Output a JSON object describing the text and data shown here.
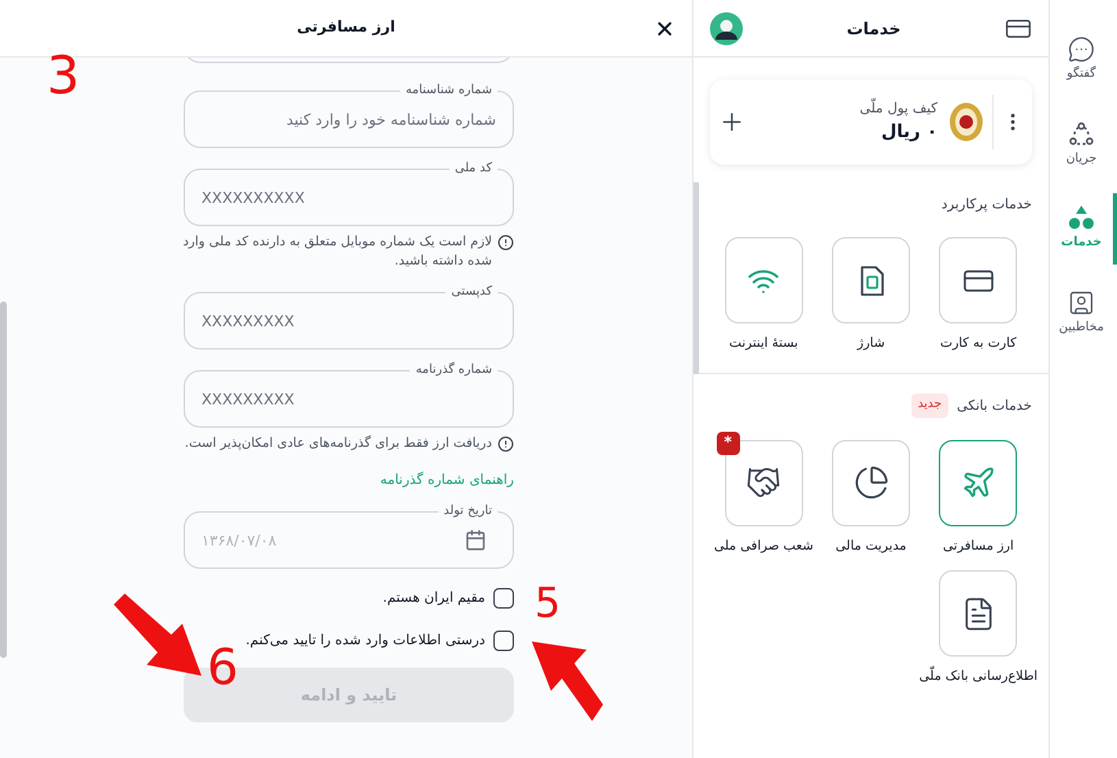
{
  "dialog": {
    "title": "ارز مسافرتی",
    "fields": [
      {
        "kind": "rtl",
        "label": "شماره شناسنامه",
        "placeholder": "شماره شناسنامه خود را وارد کنید"
      },
      {
        "kind": "ltr",
        "label": "کد ملی",
        "placeholder": "XXXXXXXXXX",
        "hint": "لازم است یک شماره موبایل متعلق به دارنده کد ملی وارد شده داشته باشید."
      },
      {
        "kind": "ltr",
        "label": "کدپستی",
        "placeholder": "XXXXXXXXX"
      },
      {
        "kind": "ltr",
        "label": "شماره گذرنامه",
        "placeholder": "XXXXXXXXX",
        "hint": "دریافت ارز فقط برای گذرنامه‌های عادی امکان‌پذیر است.",
        "link": "راهنمای شماره گذرنامه"
      },
      {
        "kind": "date",
        "label": "تاریخ تولد",
        "placeholder": "۱۳۶۸/۰۷/۰۸"
      }
    ],
    "checkboxes": [
      {
        "label": "مقیم ایران هستم.",
        "checked": false
      },
      {
        "label": "درستی اطلاعات وارد شده را تایید می‌کنم.",
        "checked": false
      }
    ],
    "submit": {
      "label": "تایید و ادامه",
      "disabled": true
    }
  },
  "services": {
    "title": "خدمات",
    "wallet": {
      "title": "کیف پول ملّی",
      "balance": "۰ ریال"
    },
    "sections": [
      {
        "title": "خدمات پرکاربرد",
        "tiles": [
          {
            "label": "کارت به کارت",
            "selected": false
          },
          {
            "label": "شارژ",
            "selected": false
          },
          {
            "label": "بستهٔ اینترنت",
            "selected": false
          }
        ]
      },
      {
        "title": "خدمات بانکی",
        "badge": "جدید",
        "tiles": [
          {
            "label": "ارز مسافرتی",
            "selected": true
          },
          {
            "label": "مدیریت مالی",
            "selected": false
          },
          {
            "label": "شعب صرافی ملی",
            "selected": false,
            "badge": "*"
          },
          {
            "label": "اطلاع‌رسانی بانک ملّی",
            "selected": false
          }
        ]
      }
    ]
  },
  "nav": [
    {
      "label": "گفتگو",
      "selected": false
    },
    {
      "label": "جریان",
      "selected": false
    },
    {
      "label": "خدمات",
      "selected": true
    },
    {
      "label": "مخاطبین",
      "selected": false
    }
  ],
  "annotations": [
    "3",
    "5",
    "6"
  ]
}
